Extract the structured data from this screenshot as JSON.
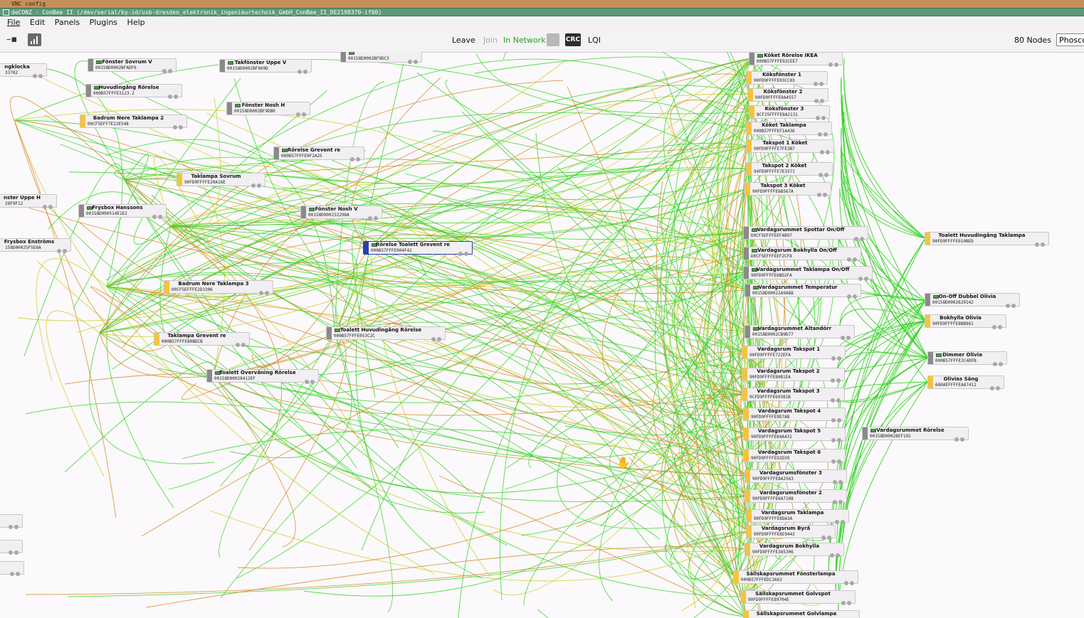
{
  "vnc": {
    "title": "VNC config"
  },
  "window": {
    "title": "deCONZ - ConBee II (/dev/serial/by-id/usb-dresden_elektronik_ingenieurtechnik_GmbH_ConBee_II_DE2198370-if00)"
  },
  "menu": {
    "file": "File",
    "edit": "Edit",
    "panels": "Panels",
    "plugins": "Plugins",
    "help": "Help"
  },
  "toolbar": {
    "leave": "Leave",
    "join": "Join",
    "status": "In Network",
    "crc_label": "CRC",
    "lqi": "LQI",
    "node_count": "80 Nodes",
    "search_value": "Phosco"
  },
  "colors": {
    "title_bar": "#5e9a7a",
    "vnc_bar": "#c6905a",
    "node_bar": "#f6c33a",
    "link_green": "#3bd42a",
    "link_yellow": "#c9d02a",
    "link_orange": "#d98a2a"
  },
  "nodes": [
    {
      "name": "Fönster Sovrum V",
      "mac": "00158D0002BFADF6"
    },
    {
      "name": "Takfönster Uppe V",
      "mac": "00158D0002BF969D"
    },
    {
      "name": "",
      "mac": "00158D0002BF9DC3"
    },
    {
      "name": "ngklocka",
      "mac": "33782"
    },
    {
      "name": "Huvudingång Rörelse",
      "mac": "000B57FFFE3123.2"
    },
    {
      "name": "Fönster Nosh H",
      "mac": "00158D0002BF9DB0"
    },
    {
      "name": "Badrum Nere Taklampa 2",
      "mac": "00CF5EFF7E22E548"
    },
    {
      "name": "Rörelse Grevent re",
      "mac": "000B57FFFE0F2A25"
    },
    {
      "name": "Taklampa Sovrum",
      "mac": "90FD9FFFFE20A16E"
    },
    {
      "name": "nster Uppe H",
      "mac": "28F9F12"
    },
    {
      "name": "Frysbox Hanssons",
      "mac": "00158D000514E1E2"
    },
    {
      "name": "Fönster Nosh V",
      "mac": "00158D000232298A"
    },
    {
      "name": "Frysbox Enströms",
      "mac": "158D00025F5E8A"
    },
    {
      "name": "Rörelse Toalett Grevent re",
      "mac": "000B57FFFE904F42"
    },
    {
      "name": "Badrum Nere Taklampa 3",
      "mac": "00CF5EFFFE2D3306"
    },
    {
      "name": "Toalett Huvudingång Rörelse",
      "mac": "000B57FFFE053C2C"
    },
    {
      "name": "Taklampa Grevent re",
      "mac": "000B57FFFE80BDCB"
    },
    {
      "name": "Toalett Övervåning Rörelse",
      "mac": "00158D00028412EF"
    },
    {
      "name": "Köket Rörelse IKEA",
      "mac": "000B57FFFE92CEE7"
    },
    {
      "name": "Köksfönster 1",
      "mac": "90FD9FFFFE03CC03"
    },
    {
      "name": "Köksfönster 2",
      "mac": "90FD9FFFFE0A4557"
    },
    {
      "name": "Köksfönster 3",
      "mac": "8CF25FFFFE8A2131"
    },
    {
      "name": "Köket Taklampa",
      "mac": "000B57FFFEF1A436"
    },
    {
      "name": "Takspot 1 Köket",
      "mac": "90FD9FFFFE7FE3B7"
    },
    {
      "name": "Takspot 2 Köket",
      "mac": "94FD9FFFFE7E3371"
    },
    {
      "name": "Takspot 3 Köket",
      "mac": "90FD9FFFFE6B567A"
    },
    {
      "name": "Vardagsrummet Spottar On/Off",
      "mac": "D0CF5EFFFEEF4B97"
    },
    {
      "name": "Vardagsrum Bokhylla On/Off",
      "mac": "D0CF5EFFFEEF2CF8"
    },
    {
      "name": "Vardagsrummet Taklampa On/Off",
      "mac": "90FD9FFFFE6BD2FA"
    },
    {
      "name": "Vardagsrummet Temperatur",
      "mac": "00158D00022A9A88"
    },
    {
      "name": "Vardagsrummet Altandörr",
      "mac": "00158D0002CB9D77"
    },
    {
      "name": "Vardagsrum Takspot 1",
      "mac": "90FD9FFFFE722EFA"
    },
    {
      "name": "Vardagsrum Takspot 2",
      "mac": "90FD9FFFFE80B1EA"
    },
    {
      "name": "Vardagsrum Takspot 3",
      "mac": "9CFD9FFFFE69381B"
    },
    {
      "name": "Vardagsrum Takspot 4",
      "mac": "90FD9FFFFE9D7AB"
    },
    {
      "name": "Vardagsrum Takspot 5",
      "mac": "90FD9FFFFE84A431"
    },
    {
      "name": "Vardagsrum Takspot 6",
      "mac": "90FD9FFFFE92D39"
    },
    {
      "name": "Vardagsrumsfönster 3",
      "mac": "90FD9FFFFE8A2563"
    },
    {
      "name": "Vardagsrumsfönster 2",
      "mac": "90FD9FFFFE6A7108"
    },
    {
      "name": "Vardagsrum Taklampa",
      "mac": "90FD9FFFFE8DA3A"
    },
    {
      "name": "Vardagsrum Byrå",
      "mac": "90FD9FFFFE8E9443"
    },
    {
      "name": "Vardagsrum Bokhylla",
      "mac": "90FD9FFFFE385306"
    },
    {
      "name": "Sällskapsrummet Fönsterlampa",
      "mac": "000B57FFFEDC3663"
    },
    {
      "name": "Sällskapsrummet Golvspot",
      "mac": "90FD9FFFFE89704E"
    },
    {
      "name": "Sällskapsrummet Golvlampa",
      "mac": ""
    },
    {
      "name": "Toalett Huvudingång Taklampa",
      "mac": "90FD9FFFFE010BED"
    },
    {
      "name": "On-Off Dubbel Olivia",
      "mac": "00158D0002629142"
    },
    {
      "name": "Bokhylla Olivia",
      "mac": "90FD9FFFFE8BB861"
    },
    {
      "name": "Dimmer Olivia",
      "mac": "000B57FFFE2C4DFB"
    },
    {
      "name": "Olivias Säng",
      "mac": "680AEFFFFEAA7411"
    },
    {
      "name": "Vardagsrummet Rörelse",
      "mac": "00158D00028EF192"
    },
    {
      "name": "",
      "mac": ""
    },
    {
      "name": "",
      "mac": ""
    },
    {
      "name": "",
      "mac": ""
    }
  ]
}
